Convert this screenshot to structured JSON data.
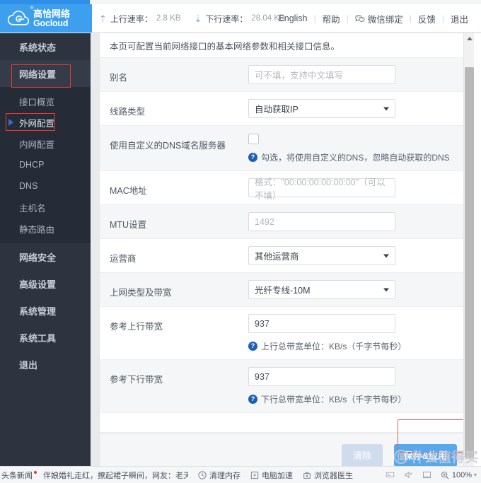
{
  "header": {
    "logo": {
      "cn": "高恰网络",
      "en": "Gocloud",
      "registered": "®",
      "icon": "cloud-logo-icon"
    },
    "upload_icon": "upload-arrow-icon",
    "upload_label": "上行速率：",
    "upload_value": "2.8 KB",
    "download_icon": "download-arrow-icon",
    "download_label": "下行速率：",
    "download_value": "28.04 KB",
    "nav": [
      {
        "label": "English",
        "icon": null
      },
      {
        "label": "帮助",
        "icon": null
      },
      {
        "label": "微信绑定",
        "icon": "wechat-icon"
      },
      {
        "label": "反馈",
        "icon": null
      },
      {
        "label": "退出",
        "icon": null
      }
    ],
    "separator": "|"
  },
  "sidebar": {
    "items": [
      {
        "label": "系统状态",
        "active": false
      },
      {
        "label": "网络设置",
        "active": true,
        "highlighted": true
      },
      {
        "label": "网络安全",
        "active": false
      },
      {
        "label": "高级设置",
        "active": false
      },
      {
        "label": "系统管理",
        "active": false
      },
      {
        "label": "系统工具",
        "active": false
      },
      {
        "label": "退出",
        "active": false
      }
    ],
    "subitems": [
      {
        "label": "接口概览",
        "selected": false
      },
      {
        "label": "外网配置",
        "selected": true,
        "highlighted": true
      },
      {
        "label": "内网配置",
        "selected": false
      },
      {
        "label": "DHCP",
        "selected": false
      },
      {
        "label": "DNS",
        "selected": false
      },
      {
        "label": "主机名",
        "selected": false
      },
      {
        "label": "静态路由",
        "selected": false
      }
    ]
  },
  "main": {
    "intro": "本页可配置当前网络接口的基本网络参数和相关接口信息。",
    "rows": [
      {
        "label": "别名",
        "type": "text",
        "value": "",
        "placeholder": "可不填，支持中文填写",
        "hint": null
      },
      {
        "label": "线路类型",
        "type": "select",
        "value": "自动获取IP",
        "hint": null
      },
      {
        "label": "使用自定义的DNS域名服务器",
        "type": "checkbox",
        "checked": false,
        "hint": "勾选，将使用自定义的DNS，忽略自动获取的DNS"
      },
      {
        "label": "MAC地址",
        "type": "text",
        "value": "",
        "placeholder": "格式：\"00:00:00:00:00:00\"（可以不填）",
        "hint": null
      },
      {
        "label": "MTU设置",
        "type": "text",
        "value": "",
        "placeholder": "1492",
        "hint": null
      },
      {
        "label": "运营商",
        "type": "select",
        "value": "其他运营商",
        "hint": null
      },
      {
        "label": "上网类型及带宽",
        "type": "select",
        "value": "光纤专线-10M",
        "hint": null
      },
      {
        "label": "参考上行带宽",
        "type": "text",
        "value": "937",
        "placeholder": "",
        "hint": "上行总带宽单位：KB/s（千字节每秒）"
      },
      {
        "label": "参考下行带宽",
        "type": "text",
        "value": "937",
        "placeholder": "",
        "hint": "下行总带宽单位：KB/s（千字节每秒）"
      }
    ],
    "hint_icon_glyph": "?",
    "buttons": {
      "clear": "清除",
      "save": "保存&应用",
      "save_highlighted": true
    }
  },
  "taskbar": {
    "news_label": "头条新闻",
    "headline": "伴娘婚礼走红，撩起裙子瞬间，网友：老天太不公平...",
    "items": [
      {
        "label": "清理内存",
        "icon": "broom-icon"
      },
      {
        "label": "电脑加速",
        "icon": "speed-icon"
      },
      {
        "label": "浏览器医生",
        "icon": "doctor-icon"
      }
    ],
    "right_icons": [
      {
        "icon": "bookmark-icon"
      },
      {
        "icon": "mute-icon"
      },
      {
        "icon": "window-icon"
      }
    ],
    "zoom_icon": "zoom-in-icon",
    "zoom_level": "100%",
    "zoom_chevron": "chevron-down-icon"
  },
  "watermark": {
    "circle": "值",
    "text": "什么值得买"
  },
  "colors": {
    "brand_blue": "#3da0ef",
    "sidebar_bg": "#2d3440",
    "highlight_red": "#e8392c",
    "save_button": "#57a9ee",
    "hint_icon": "#1d5fb4"
  }
}
